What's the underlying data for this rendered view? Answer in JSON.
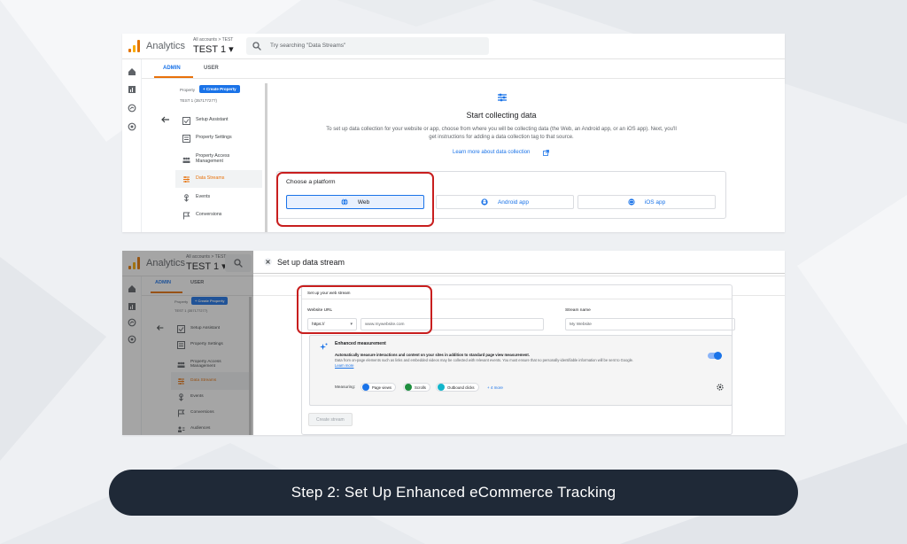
{
  "banner": {
    "text": "Step 2: Set Up Enhanced eCommerce Tracking"
  },
  "colors": {
    "brand_blue": "#1a73e8",
    "active_orange": "#e8710a",
    "callout_red": "#c81e1e",
    "banner_bg": "#1f2937"
  },
  "screen1": {
    "app_name": "Analytics",
    "account_breadcrumb": "All accounts > TEST",
    "property_name": "TEST 1 ▾",
    "search_placeholder": "Try searching \"Data Streams\"",
    "rail_icons": [
      "home-icon",
      "reports-icon",
      "explore-icon",
      "advertising-icon"
    ],
    "tabs": {
      "admin": "ADMIN",
      "user": "USER"
    },
    "property_label": "Property",
    "create_property": "+ Create Property",
    "property_id": "TEST 1 (357177277)",
    "nav": [
      {
        "label": "Setup Assistant",
        "icon": "checklist-icon"
      },
      {
        "label": "Property Settings",
        "icon": "settings-page-icon"
      },
      {
        "label": "Property Access Management",
        "icon": "people-icon"
      },
      {
        "label": "Data Streams",
        "icon": "data-streams-icon",
        "selected": true
      },
      {
        "label": "Events",
        "icon": "touch-icon"
      },
      {
        "label": "Conversions",
        "icon": "flag-icon"
      }
    ],
    "heading": "Start collecting data",
    "description_line1": "To set up data collection for your website or app, choose from where you will be collecting data (the Web, an Android app, or an iOS app). Next, you'll",
    "description_line2": "get instructions for adding a data collection tag to that source.",
    "learn_more": "Learn more about data collection",
    "choose_platform": "Choose a platform",
    "platforms": [
      {
        "label": "Web",
        "icon": "globe-icon"
      },
      {
        "label": "Android app",
        "icon": "android-icon"
      },
      {
        "label": "iOS app",
        "icon": "ios-icon"
      }
    ]
  },
  "screen2": {
    "app_name": "Analytics",
    "account_breadcrumb": "All accounts > TEST",
    "property_name": "TEST 1 ▾",
    "tabs": {
      "admin": "ADMIN",
      "user": "USER"
    },
    "property_label": "Property",
    "create_property": "+ Create Property",
    "property_id": "TEST 1 (357177277)",
    "nav": [
      {
        "label": "Setup Assistant",
        "icon": "checklist-icon"
      },
      {
        "label": "Property Settings",
        "icon": "settings-page-icon"
      },
      {
        "label": "Property Access Management",
        "icon": "people-icon"
      },
      {
        "label": "Data Streams",
        "icon": "data-streams-icon",
        "selected": true
      },
      {
        "label": "Events",
        "icon": "touch-icon"
      },
      {
        "label": "Conversions",
        "icon": "flag-icon"
      },
      {
        "label": "Audiences",
        "icon": "audiences-icon"
      }
    ],
    "panel_title": "Set up data stream",
    "section_title": "Set up your web stream",
    "website_url_label": "Website URL",
    "protocol": "https://",
    "url_placeholder": "www.mywebsite.com",
    "stream_name_label": "Stream name",
    "stream_name_placeholder": "My Website",
    "enhanced_title": "Enhanced measurement",
    "enhanced_desc1": "Automatically measure interactions and content on your sites in addition to standard page view measurement.",
    "enhanced_desc2": "Data from on-page elements such as links and embedded videos may be collected with relevant events. You must ensure that no personally-identifiable information will be sent to Google.",
    "enhanced_learn": "Learn more",
    "enhanced_on": true,
    "measuring_label": "Measuring:",
    "chips": [
      {
        "label": "Page views",
        "color": "#1a73e8"
      },
      {
        "label": "Scrolls",
        "color": "#1e8e3e"
      },
      {
        "label": "Outbound clicks",
        "color": "#12b5cb"
      }
    ],
    "more": "+ 4 more",
    "create_stream": "Create stream"
  }
}
